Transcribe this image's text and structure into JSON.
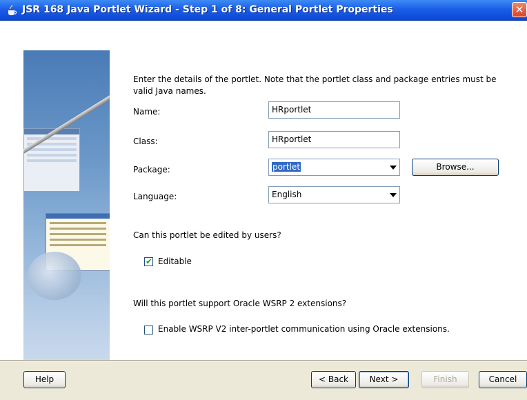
{
  "window": {
    "title": "JSR 168 Java Portlet Wizard - Step 1 of 8: General Portlet Properties",
    "close_glyph": "✕"
  },
  "instructions": "Enter the details of the portlet. Note that the portlet class and package entries must be valid Java names.",
  "form": {
    "name_label": "Name:",
    "name_value": "HRportlet",
    "class_label": "Class:",
    "class_value": "HRportlet",
    "package_label": "Package:",
    "package_value": "portlet",
    "browse_label": "Browse...",
    "language_label": "Language:",
    "language_value": "English"
  },
  "edit_section": {
    "question": "Can this portlet be edited by users?",
    "editable_label": "Editable",
    "editable_checked": true
  },
  "wsrp_section": {
    "question": "Will this portlet support Oracle WSRP 2 extensions?",
    "enable_label": "Enable WSRP V2 inter-portlet communication using Oracle extensions.",
    "enable_checked": false
  },
  "buttons": {
    "help": "Help",
    "back": "< Back",
    "next": "Next >",
    "finish": "Finish",
    "cancel": "Cancel"
  },
  "colors": {
    "titlebar": "#1c5ee8",
    "dialog_bg": "#ece9d8",
    "selection": "#316ac5"
  },
  "icons": {
    "app": "java-cup-icon",
    "close": "close-icon",
    "dropdown": "chevron-down-icon",
    "check": "checkmark-icon"
  }
}
